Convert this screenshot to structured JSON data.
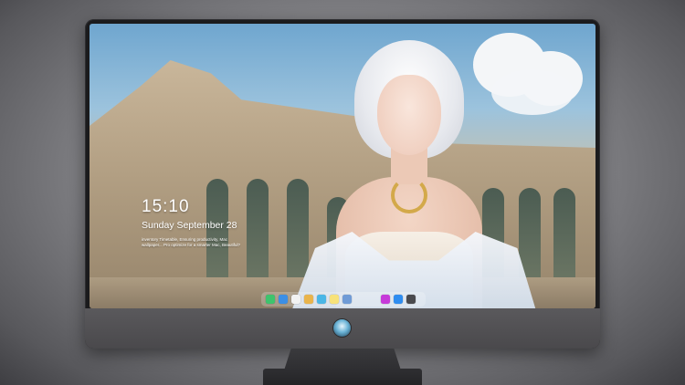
{
  "lock_screen": {
    "time": "15:10",
    "date": "Sunday September 28",
    "notice_line1": "inventory   Timetable, Ensuring productivity, Mac",
    "notice_line2": "wallpaper... Pro optimize for a smarter Mac, Beautiful?"
  },
  "dock": {
    "items": [
      {
        "name": "messages-icon",
        "color": "#3ec46d"
      },
      {
        "name": "finder-icon",
        "color": "#3b8fe6"
      },
      {
        "name": "chrome-icon",
        "color": "#f2f2f2"
      },
      {
        "name": "photos-icon",
        "color": "#e9b44c"
      },
      {
        "name": "files-icon",
        "color": "#4ab6e6"
      },
      {
        "name": "notes-icon",
        "color": "#f7e27a"
      },
      {
        "name": "preview-icon",
        "color": "#6f9bd6"
      },
      {
        "name": "music-icon",
        "color": "#c63bd9"
      },
      {
        "name": "app-store-icon",
        "color": "#2f8df0"
      },
      {
        "name": "camera-icon",
        "color": "#4a4a4e"
      }
    ]
  },
  "monitor": {
    "logo_icon": "app-logo-icon",
    "accent": "#6ab3d6"
  }
}
